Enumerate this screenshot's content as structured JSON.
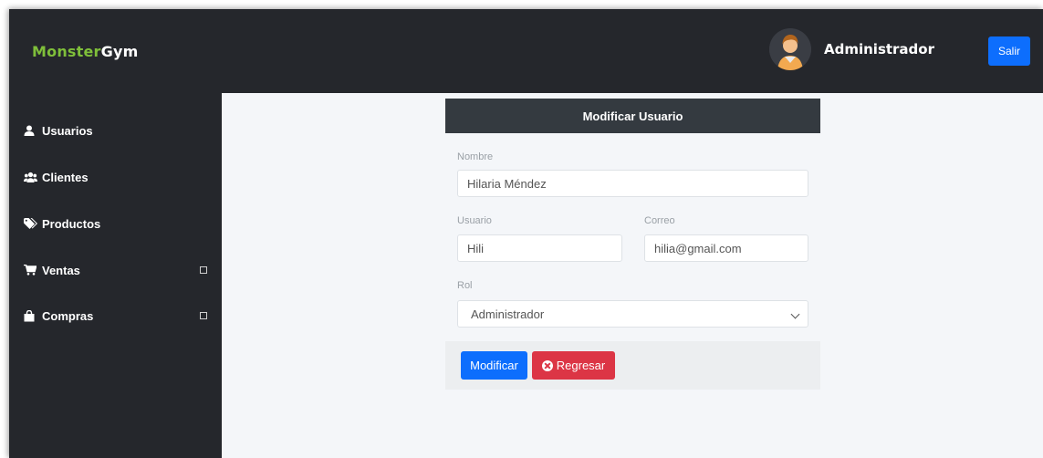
{
  "brand": {
    "part1": "Monster",
    "part2": "Gym"
  },
  "header": {
    "user_name": "Administrador",
    "logout_label": "Salir"
  },
  "sidebar": {
    "items": [
      {
        "label": "Usuarios",
        "icon": "user-icon",
        "has_submenu": false
      },
      {
        "label": "Clientes",
        "icon": "users-icon",
        "has_submenu": false
      },
      {
        "label": "Productos",
        "icon": "tag-icon",
        "has_submenu": false
      },
      {
        "label": "Ventas",
        "icon": "cart-icon",
        "has_submenu": true
      },
      {
        "label": "Compras",
        "icon": "bag-icon",
        "has_submenu": true
      }
    ]
  },
  "form": {
    "title": "Modificar Usuario",
    "nombre_label": "Nombre",
    "nombre_value": "Hilaria Méndez",
    "usuario_label": "Usuario",
    "usuario_value": "Hili",
    "correo_label": "Correo",
    "correo_value": "hilia@gmail.com",
    "rol_label": "Rol",
    "rol_value": "Administrador",
    "modify_label": "Modificar",
    "back_label": "Regresar"
  },
  "colors": {
    "sidebar_bg": "#25272c",
    "brand_accent": "#7fbf3a",
    "primary": "#0d6efd",
    "danger": "#dc3545",
    "card_header": "#343a40"
  }
}
